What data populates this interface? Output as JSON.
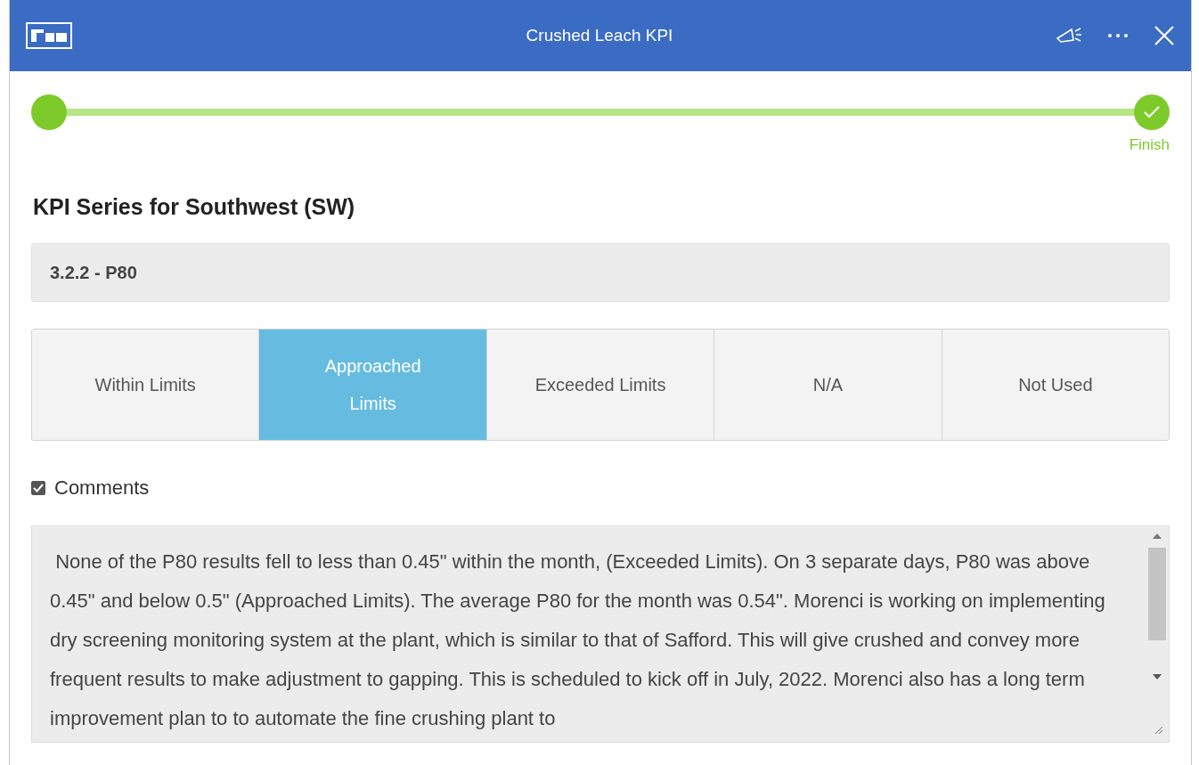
{
  "window": {
    "title": "Crushed Leach KPI"
  },
  "progress": {
    "level": 1,
    "end_label": "Finish",
    "complete": true
  },
  "heading": "KPI Series for Southwest (SW)",
  "series_item": "3.2.2 - P80",
  "options": [
    {
      "label": "Within Limits",
      "selected": false
    },
    {
      "label": "Approached Limits",
      "selected": true
    },
    {
      "label": "Exceeded Limits",
      "selected": false
    },
    {
      "label": "N/A",
      "selected": false
    },
    {
      "label": "Not Used",
      "selected": false
    }
  ],
  "comments": {
    "label": "Comments",
    "checked": true,
    "value": " None of the P80 results fell to less than 0.45\" within the month, (Exceeded Limits). On 3 separate days, P80 was above 0.45\" and below 0.5\" (Approached Limits). The average P80 for the month was 0.54\". Morenci is working on implementing dry screening monitoring system at the plant, which is similar to that of Safford. This will give crushed and convey more frequent results to make adjustment to gapping. This is scheduled to kick off in July, 2022. Morenci also has a long term improvement plan to to automate the fine crushing plant to"
  }
}
